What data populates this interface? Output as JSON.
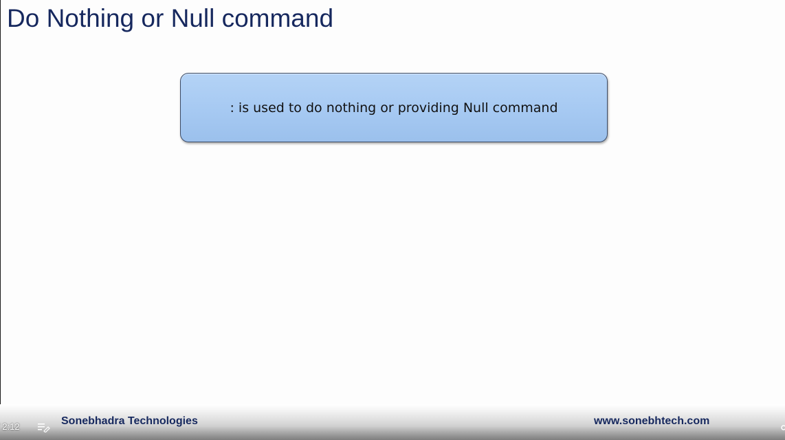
{
  "slide": {
    "title": "Do Nothing or Null command",
    "callout_text": ": is used to do nothing or providing Null command"
  },
  "footer": {
    "company": "Sonebhadra Technologies",
    "website": "www.sonebhtech.com"
  },
  "player": {
    "time_display": "/ 2:12",
    "chapters_icon": "playlist-edit-icon"
  },
  "colors": {
    "title": "#16285e",
    "callout_fill": "#a6c9f2",
    "callout_border": "#3a4a66",
    "footer_text": "#16285e"
  }
}
